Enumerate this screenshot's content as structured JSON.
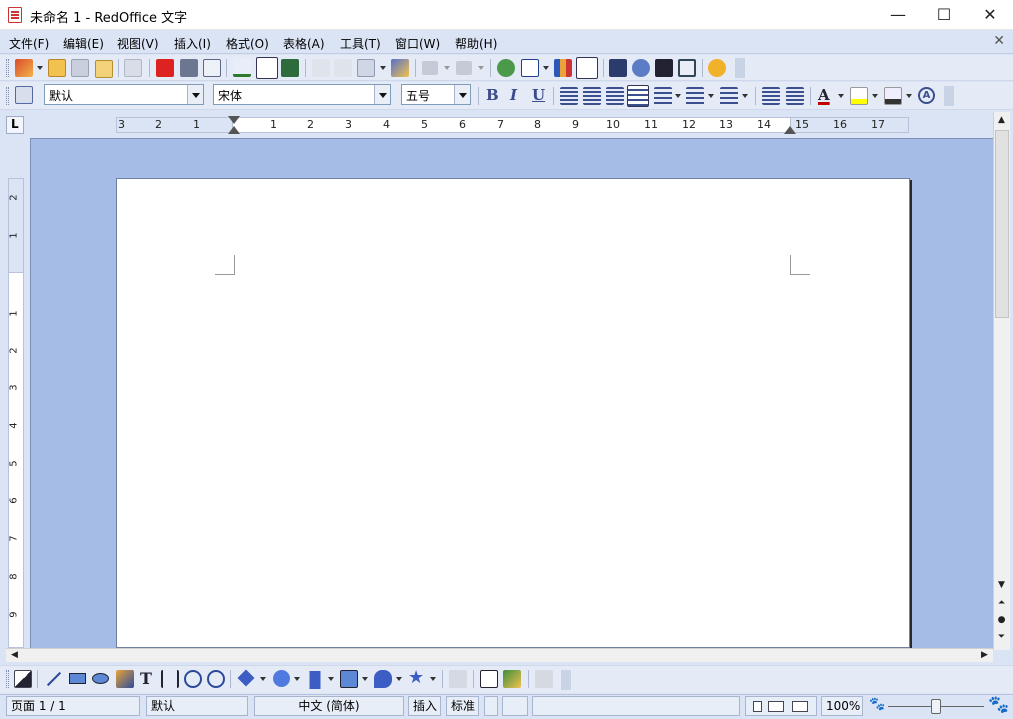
{
  "window": {
    "title": "未命名 1 - RedOffice 文字",
    "controls": {
      "minimize": "—",
      "maximize": "☐",
      "close": "✕"
    }
  },
  "menu": {
    "items": [
      "文件(F)",
      "编辑(E)",
      "视图(V)",
      "插入(I)",
      "格式(O)",
      "表格(A)",
      "工具(T)",
      "窗口(W)",
      "帮助(H)"
    ],
    "close_doc": "✕"
  },
  "format_bar": {
    "style_value": "默认",
    "font_value": "宋体",
    "size_value": "五号",
    "bold": "B",
    "italic": "I",
    "underline": "U",
    "font_color_letter": "A",
    "char_shading_letter": "A"
  },
  "ruler": {
    "horizontal_labels": [
      "3",
      "2",
      "1",
      "1",
      "2",
      "3",
      "4",
      "5",
      "6",
      "7",
      "8",
      "9",
      "10",
      "11",
      "12",
      "13",
      "14",
      "15",
      "16",
      "17"
    ],
    "vertical_labels": [
      "2",
      "1",
      "1",
      "2",
      "3",
      "4",
      "5",
      "6",
      "7",
      "8",
      "9"
    ]
  },
  "status": {
    "page": "页面 1 / 1",
    "style": "默认",
    "language": "中文 (简体)",
    "insert_mode": "插入",
    "selection_mode": "标准",
    "zoom": "100%"
  },
  "colors": {
    "canvas_bg": "#a5bde6",
    "toolbar_bg": "#e4ebf7",
    "font_color_bar": "#c00000",
    "highlight_bar": "#ffff00"
  }
}
